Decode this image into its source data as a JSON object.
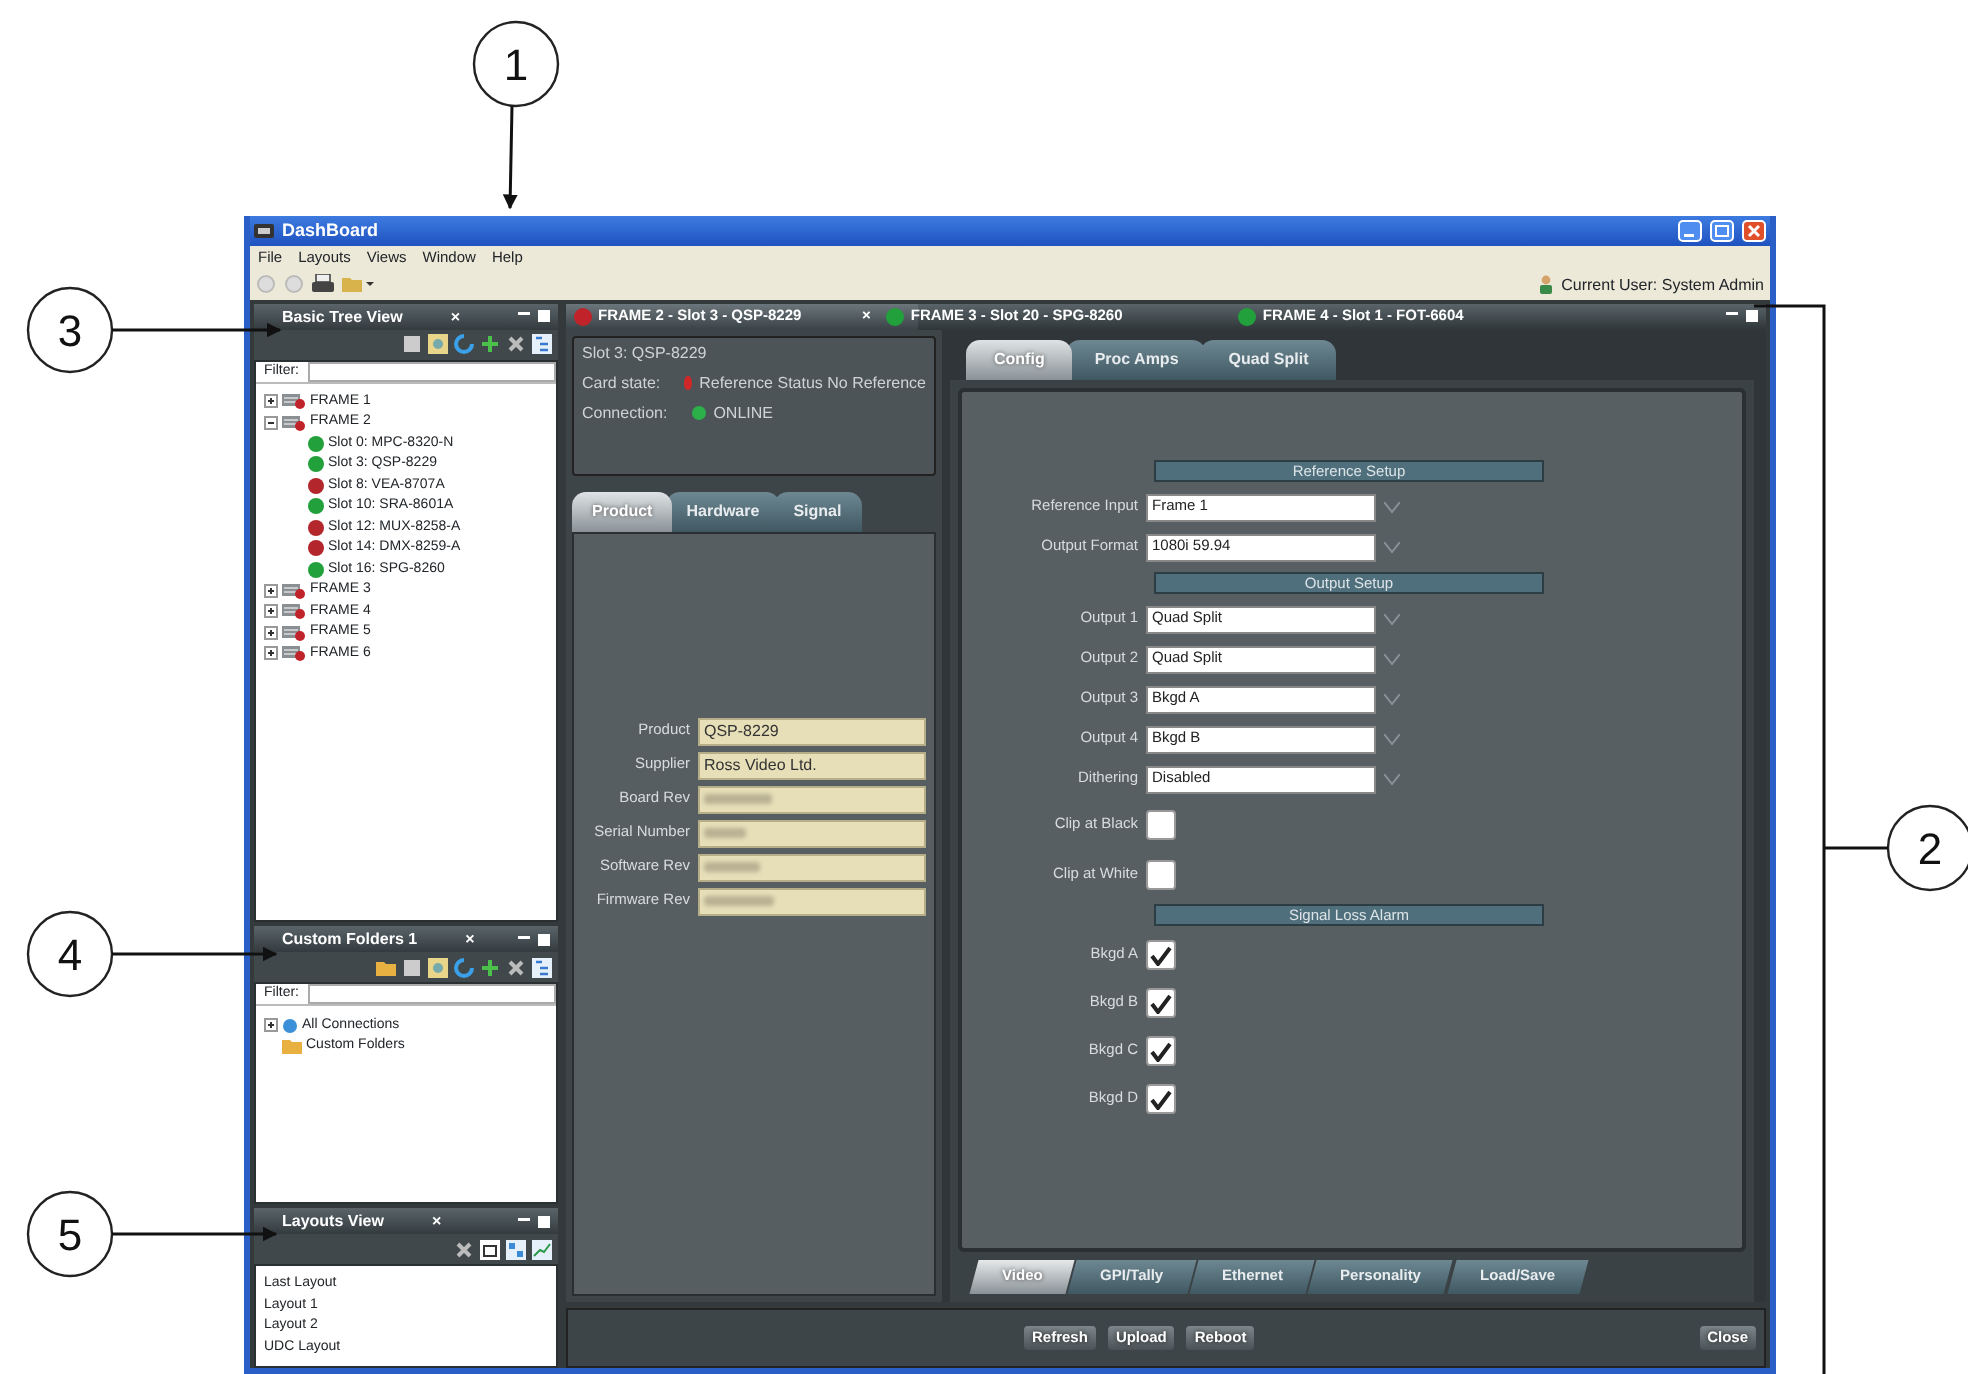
{
  "callouts": [
    {
      "label": "1"
    },
    {
      "label": "2"
    },
    {
      "label": "3"
    },
    {
      "label": "4"
    },
    {
      "label": "5"
    }
  ],
  "window": {
    "title": "DashBoard"
  },
  "menu": [
    "File",
    "Layouts",
    "Views",
    "Window",
    "Help"
  ],
  "current_user": "Current User: System Admin",
  "tree_view": {
    "title": "Basic Tree View",
    "close": "×",
    "filter_label": "Filter:",
    "items": [
      {
        "label": "FRAME 1",
        "expanded": false
      },
      {
        "label": "FRAME 2",
        "expanded": true,
        "children": [
          {
            "label": "Slot 0: MPC-8320-N",
            "color": "#22a03c"
          },
          {
            "label": "Slot 3: QSP-8229",
            "color": "#22a03c"
          },
          {
            "label": "Slot 8: VEA-8707A",
            "color": "#b3262c"
          },
          {
            "label": "Slot 10: SRA-8601A",
            "color": "#22a03c"
          },
          {
            "label": "Slot 12: MUX-8258-A",
            "color": "#b3262c"
          },
          {
            "label": "Slot 14: DMX-8259-A",
            "color": "#b3262c"
          },
          {
            "label": "Slot 16: SPG-8260",
            "color": "#22a03c"
          }
        ]
      },
      {
        "label": "FRAME 3",
        "expanded": false
      },
      {
        "label": "FRAME 4",
        "expanded": false
      },
      {
        "label": "FRAME 5",
        "expanded": false
      },
      {
        "label": "FRAME 6",
        "expanded": false
      }
    ]
  },
  "custom_folders": {
    "title": "Custom Folders 1",
    "close": "×",
    "filter_label": "Filter:",
    "items": [
      {
        "label": "All Connections",
        "kind": "connections",
        "expanded": false
      },
      {
        "label": "Custom Folders",
        "kind": "folder"
      }
    ]
  },
  "layouts_view": {
    "title": "Layouts View",
    "close": "×",
    "items": [
      "Last Layout",
      "Layout 1",
      "Layout 2",
      "UDC Layout"
    ]
  },
  "doc_tabs": [
    {
      "label": "FRAME 2 - Slot 3 - QSP-8229",
      "color": "#c0242a",
      "selected": true,
      "close": "×"
    },
    {
      "label": "FRAME 3 - Slot 20 - SPG-8260",
      "color": "#22a03c",
      "selected": false
    },
    {
      "label": "FRAME 4 - Slot 1 - FOT-6604",
      "color": "#22a03c",
      "selected": false
    }
  ],
  "card_info": {
    "slot": "Slot 3: QSP-8229",
    "card_state": {
      "label": "Card state:",
      "value": "Reference Status No Reference",
      "color": "#d02828"
    },
    "connection": {
      "label": "Connection:",
      "value": "ONLINE",
      "color": "#2cb04a"
    }
  },
  "card_tabs": [
    {
      "label": "Product",
      "selected": true
    },
    {
      "label": "Hardware",
      "selected": false
    },
    {
      "label": "Signal",
      "selected": false
    }
  ],
  "product_fields": [
    {
      "label": "Product",
      "value": "QSP-8229",
      "blurred": false
    },
    {
      "label": "Supplier",
      "value": "Ross Video Ltd.",
      "blurred": false
    },
    {
      "label": "Board Rev",
      "blurred": true
    },
    {
      "label": "Serial Number",
      "blurred": true
    },
    {
      "label": "Software Rev",
      "blurred": true
    },
    {
      "label": "Firmware Rev",
      "blurred": true
    }
  ],
  "config_tabs": [
    {
      "label": "Config",
      "selected": true
    },
    {
      "label": "Proc Amps",
      "selected": false
    },
    {
      "label": "Quad Split",
      "selected": false
    }
  ],
  "config_rows": [
    {
      "kind": "heading",
      "label": "Reference Setup"
    },
    {
      "kind": "select",
      "label": "Reference Input",
      "value": "Frame 1"
    },
    {
      "kind": "select",
      "label": "Output Format",
      "value": "1080i 59.94"
    },
    {
      "kind": "heading",
      "label": "Output Setup"
    },
    {
      "kind": "select",
      "label": "Output 1",
      "value": "Quad Split"
    },
    {
      "kind": "select",
      "label": "Output 2",
      "value": "Quad Split"
    },
    {
      "kind": "select",
      "label": "Output 3",
      "value": "Bkgd A"
    },
    {
      "kind": "select",
      "label": "Output 4",
      "value": "Bkgd B"
    },
    {
      "kind": "select",
      "label": "Dithering",
      "value": "Disabled"
    },
    {
      "kind": "checkbox",
      "label": "Clip at Black",
      "checked": false
    },
    {
      "kind": "checkbox",
      "label": "Clip at White",
      "checked": false
    },
    {
      "kind": "heading",
      "label": "Signal Loss Alarm"
    },
    {
      "kind": "checkbox",
      "label": "Bkgd A",
      "checked": true
    },
    {
      "kind": "checkbox",
      "label": "Bkgd B",
      "checked": true
    },
    {
      "kind": "checkbox",
      "label": "Bkgd C",
      "checked": true
    },
    {
      "kind": "checkbox",
      "label": "Bkgd D",
      "checked": true
    }
  ],
  "bottom_tabs": [
    {
      "label": "Video",
      "selected": true
    },
    {
      "label": "GPI/Tally",
      "selected": false
    },
    {
      "label": "Ethernet",
      "selected": false
    },
    {
      "label": "Personality",
      "selected": false
    },
    {
      "label": "Load/Save",
      "selected": false
    }
  ],
  "buttons": [
    "Refresh",
    "Upload",
    "Reboot"
  ],
  "close_button": "Close"
}
